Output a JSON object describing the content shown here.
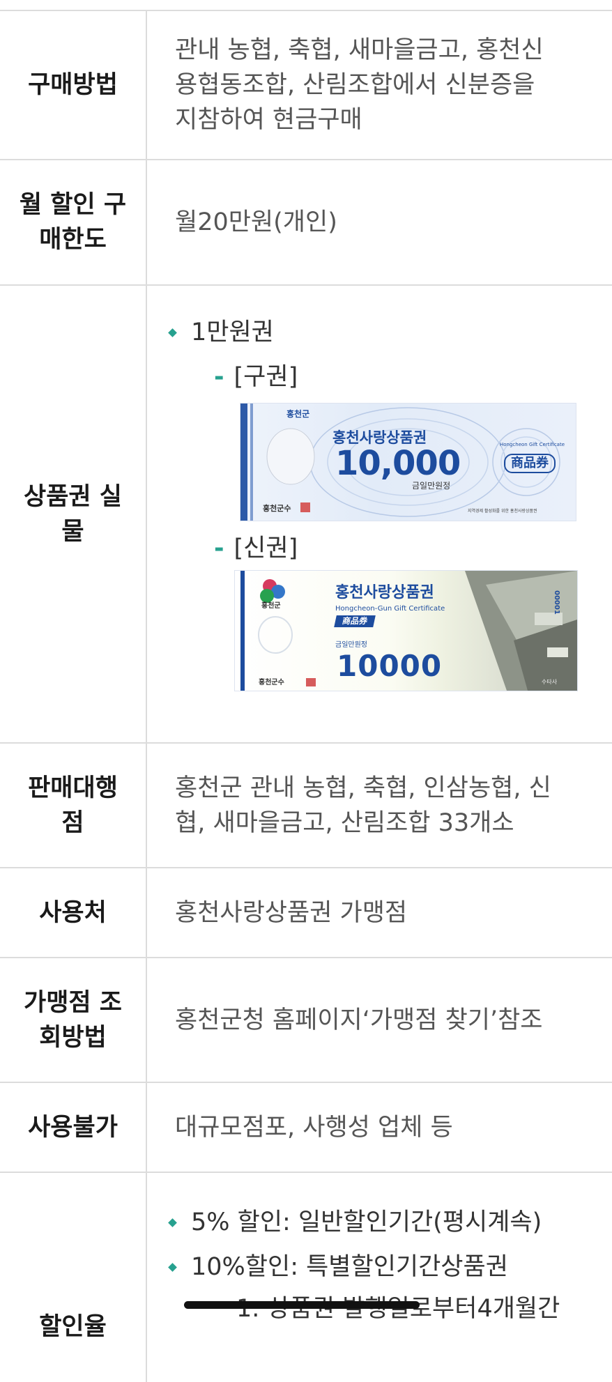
{
  "rows": [
    {
      "label": "구매방법",
      "value_lines": [
        "관내 농협, 축협, 새마을금고, 홍천신",
        "용협동조합, 산림조합에서 신분증을",
        "지참하여 현금구매"
      ]
    },
    {
      "label_lines": [
        "월 할인",
        "구매한도"
      ],
      "value": "월20만원(개인)"
    },
    {
      "label_lines": [
        "상품권",
        "실물"
      ],
      "bullet": "1만원권",
      "old_label": "[구권]",
      "new_label": "[신권]"
    },
    {
      "label_lines": [
        "판매대행",
        "점"
      ],
      "value_lines": [
        "홍천군 관내 농협, 축협, 인삼농협, 신",
        "협, 새마을금고, 산림조합 33개소"
      ]
    },
    {
      "label": "사용처",
      "value": "홍천사랑상품권 가맹점"
    },
    {
      "label_lines": [
        "가맹점",
        "조회방법"
      ],
      "value": "홍천군청 홈페이지‘가맹점 찾기’참조"
    },
    {
      "label": "사용불가",
      "value": "대규모점포, 사행성 업체 등"
    },
    {
      "label": "할인율",
      "bullets": [
        "5% 할인: 일반할인기간(평시계속)",
        "10%할인: 특별할인기간상품권"
      ],
      "sub_item": "1. 상품권 발행일로부터4개월간"
    }
  ],
  "voucher_old": {
    "brand": "홍천군",
    "title": "홍천사랑상품권",
    "amount": "10,000",
    "amount_words": "금일만원정",
    "cert": "Hongcheon Gift Certificate",
    "stamp": "商品券",
    "issuer": "홍천군수",
    "slogan": "지역경제 활성화를 위한 홍천사랑상품권"
  },
  "voucher_new": {
    "brand": "홍천군",
    "title": "홍천사랑상품권",
    "cert": "Hongcheon-Gun Gift Certificate",
    "stamp": "商品券",
    "amount_words": "금일만원정",
    "amount": "10000",
    "issuer": "홍천군수",
    "serial": "00001",
    "side": "수타사"
  },
  "colors": {
    "accent": "#27a18f",
    "border": "#dcdcdc",
    "voucher_blue": "#1d4c9e"
  }
}
